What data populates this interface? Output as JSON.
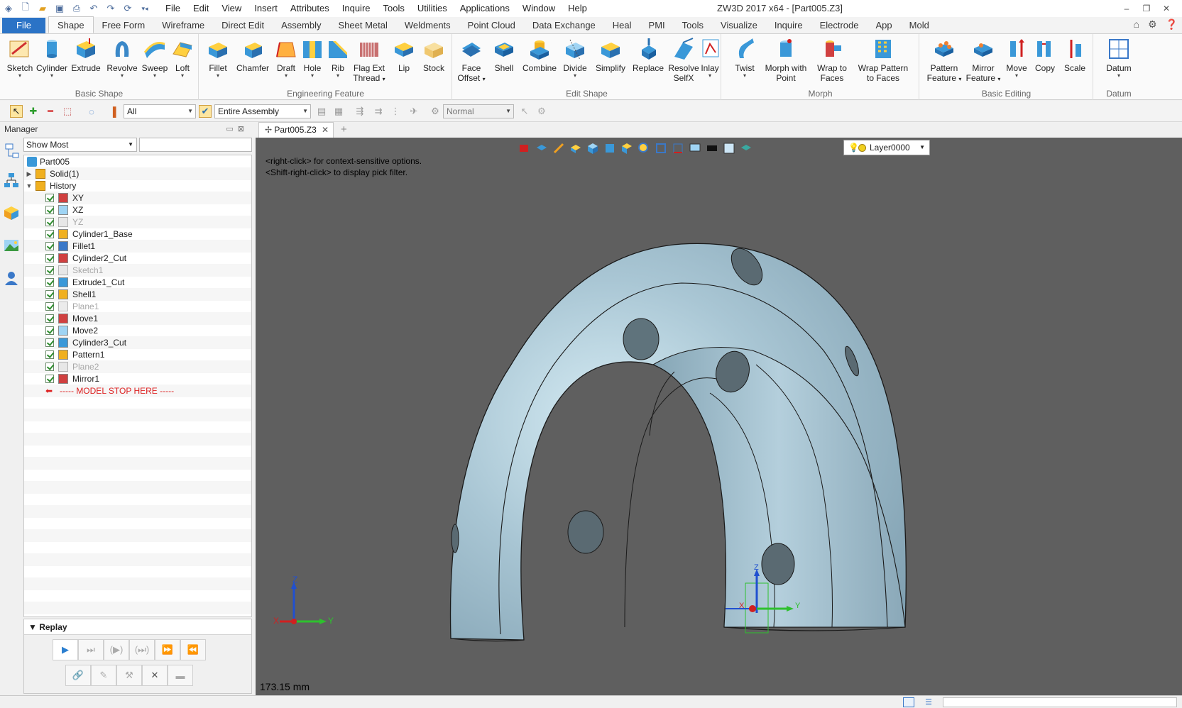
{
  "window": {
    "title": "ZW3D 2017  x64 - [Part005.Z3]",
    "menus": [
      "File",
      "Edit",
      "View",
      "Insert",
      "Attributes",
      "Inquire",
      "Tools",
      "Utilities",
      "Applications",
      "Window",
      "Help"
    ]
  },
  "ribbon_tabs": [
    "File",
    "Shape",
    "Free Form",
    "Wireframe",
    "Direct Edit",
    "Assembly",
    "Sheet Metal",
    "Weldments",
    "Point Cloud",
    "Data Exchange",
    "Heal",
    "PMI",
    "Tools",
    "Visualize",
    "Inquire",
    "Electrode",
    "App",
    "Mold"
  ],
  "active_tab": "Shape",
  "ribbon_groups": {
    "basic_shape": {
      "name": "Basic Shape",
      "buttons": [
        "Sketch",
        "Cylinder",
        "Extrude",
        "Revolve",
        "Sweep",
        "Loft"
      ]
    },
    "engineering_feature": {
      "name": "Engineering Feature",
      "buttons": [
        "Fillet",
        "Chamfer",
        "Draft",
        "Hole",
        "Rib",
        "Flag Ext",
        "Thread",
        "Lip",
        "Stock"
      ]
    },
    "edit_shape": {
      "name": "Edit Shape",
      "buttons": [
        "Face",
        "Offset",
        "Shell",
        "Combine",
        "Divide",
        "Simplify",
        "Replace",
        "Resolve",
        "SelfX",
        "Inlay"
      ]
    },
    "morph": {
      "name": "Morph",
      "buttons": [
        "Twist",
        "Morph with",
        "Point",
        "Wrap to",
        "Faces",
        "Wrap Pattern",
        "to Faces"
      ]
    },
    "basic_editing": {
      "name": "Basic Editing",
      "buttons": [
        "Pattern",
        "Feature",
        "Mirror",
        "Feature",
        "Move",
        "Copy",
        "Scale"
      ]
    },
    "datum": {
      "name": "Datum",
      "buttons": [
        "Datum"
      ]
    }
  },
  "toolbar": {
    "filter_value": "All",
    "scope_value": "Entire Assembly",
    "mode_value": "Normal"
  },
  "manager": {
    "title": "Manager",
    "show_filter": "Show Most",
    "tree": [
      {
        "label": "Part005",
        "level": 0,
        "dim": false
      },
      {
        "label": "Solid(1)",
        "level": 1,
        "dim": false
      },
      {
        "label": "History",
        "level": 1,
        "dim": false
      },
      {
        "label": "XY",
        "level": 2,
        "dim": false
      },
      {
        "label": "XZ",
        "level": 2,
        "dim": false
      },
      {
        "label": "YZ",
        "level": 2,
        "dim": true
      },
      {
        "label": "Cylinder1_Base",
        "level": 2,
        "dim": false
      },
      {
        "label": "Fillet1",
        "level": 2,
        "dim": false
      },
      {
        "label": "Cylinder2_Cut",
        "level": 2,
        "dim": false
      },
      {
        "label": "Sketch1",
        "level": 2,
        "dim": true
      },
      {
        "label": "Extrude1_Cut",
        "level": 2,
        "dim": false
      },
      {
        "label": "Shell1",
        "level": 2,
        "dim": false
      },
      {
        "label": "Plane1",
        "level": 2,
        "dim": true
      },
      {
        "label": "Move1",
        "level": 2,
        "dim": false
      },
      {
        "label": "Move2",
        "level": 2,
        "dim": false
      },
      {
        "label": "Cylinder3_Cut",
        "level": 2,
        "dim": false
      },
      {
        "label": "Pattern1",
        "level": 2,
        "dim": false
      },
      {
        "label": "Plane2",
        "level": 2,
        "dim": true
      },
      {
        "label": "Mirror1",
        "level": 2,
        "dim": false
      }
    ],
    "stop_marker": "----- MODEL STOP HERE -----",
    "replay_title": "Replay"
  },
  "document_tab": "Part005.Z3",
  "viewport": {
    "hint_line1": "<right-click> for context-sensitive options.",
    "hint_line2": "<Shift-right-click> to display pick filter.",
    "layer": "Layer0000",
    "scale_readout": "173.15 mm",
    "axis_x": "X",
    "axis_y": "Y",
    "axis_z": "Z"
  },
  "colors": {
    "accent": "#2b73c6",
    "viewport_bg": "#5f5f5f",
    "part_fill": "#a9c6d4",
    "stop_red": "#d22222"
  }
}
